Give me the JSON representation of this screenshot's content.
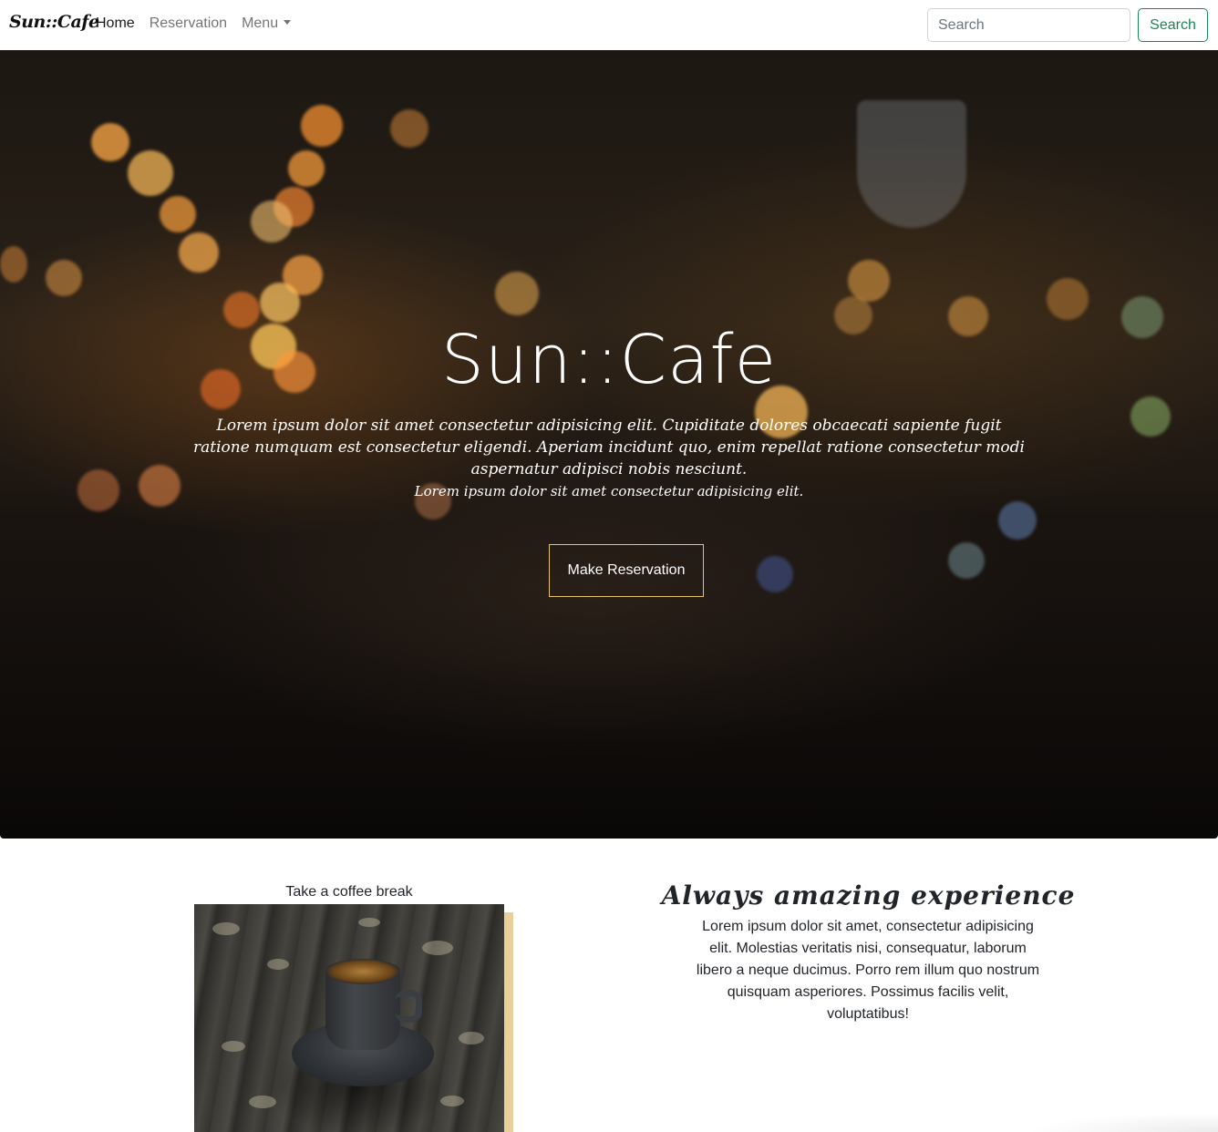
{
  "navbar": {
    "brand": "Sun::Cafe",
    "links": [
      "Home",
      "Reservation",
      "Menu"
    ],
    "search_placeholder": "Search",
    "search_button": "Search"
  },
  "hero": {
    "title": "Sun::Cafe",
    "text": "Lorem ipsum dolor sit amet consectetur adipisicing elit. Cupiditate dolores obcaecati sapiente fugit ratione numquam est consectetur eligendi. Aperiam incidunt quo, enim repellat ratione consectetur modi aspernatur adipisci nobis nesciunt.",
    "subtext": "Lorem ipsum dolor sit amet consectetur adipisicing elit.",
    "button": "Make Reservation"
  },
  "feature": {
    "caption": "Take a coffee break",
    "title": "Always amazing experience",
    "text": "Lorem ipsum dolor sit amet, consectetur adipisicing elit. Molestias veritatis nisi, consequatur, laborum libero a neque ducimus. Porro rem illum quo nostrum quisquam asperiores. Possimus facilis velit, voluptatibus!"
  },
  "colors": {
    "search_button": "#198754",
    "reservation_border": "#e8c46a",
    "photo_accent": "#e9cf98"
  }
}
